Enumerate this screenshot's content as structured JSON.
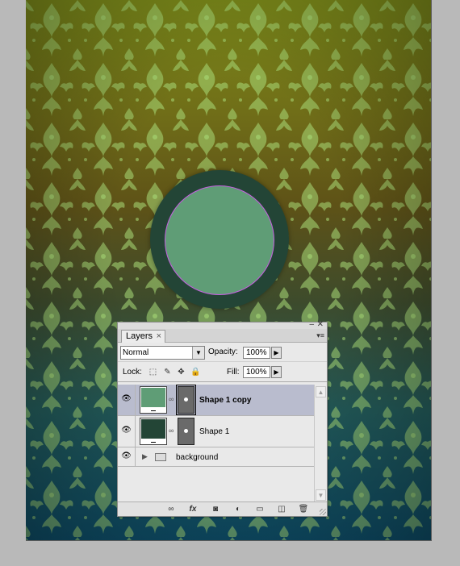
{
  "panel": {
    "tab_label": "Layers",
    "tab_close": "×",
    "minimize_glyph": "–",
    "close_glyph": "✕",
    "menu_glyph": "▾≡",
    "blend_mode": "Normal",
    "opacity_label": "Opacity:",
    "opacity_value": "100%",
    "lock_label": "Lock:",
    "fill_label": "Fill:",
    "fill_value": "100%"
  },
  "layers": [
    {
      "name": "Shape 1 copy",
      "selected": true,
      "visible": true,
      "thumb_color": "#5f9d76",
      "eye": "👁"
    },
    {
      "name": "Shape 1",
      "selected": false,
      "visible": true,
      "thumb_color": "#234536",
      "eye": "👁"
    },
    {
      "name": "background",
      "selected": false,
      "visible": true,
      "type": "group",
      "eye": "👁"
    }
  ],
  "lock_icons": [
    "lock-transparent-icon",
    "lock-image-icon",
    "lock-position-icon",
    "lock-all-icon"
  ],
  "bottom_icons": [
    "link-layers-icon",
    "fx-icon",
    "add-mask-icon",
    "adjustment-layer-icon",
    "new-group-icon",
    "new-layer-icon",
    "delete-layer-icon"
  ],
  "colors": {
    "ring": "#234536",
    "inner_circle": "#5f9d76",
    "selection_outline": "#c65fe0",
    "selected_layer_bg": "#b9bcce"
  }
}
